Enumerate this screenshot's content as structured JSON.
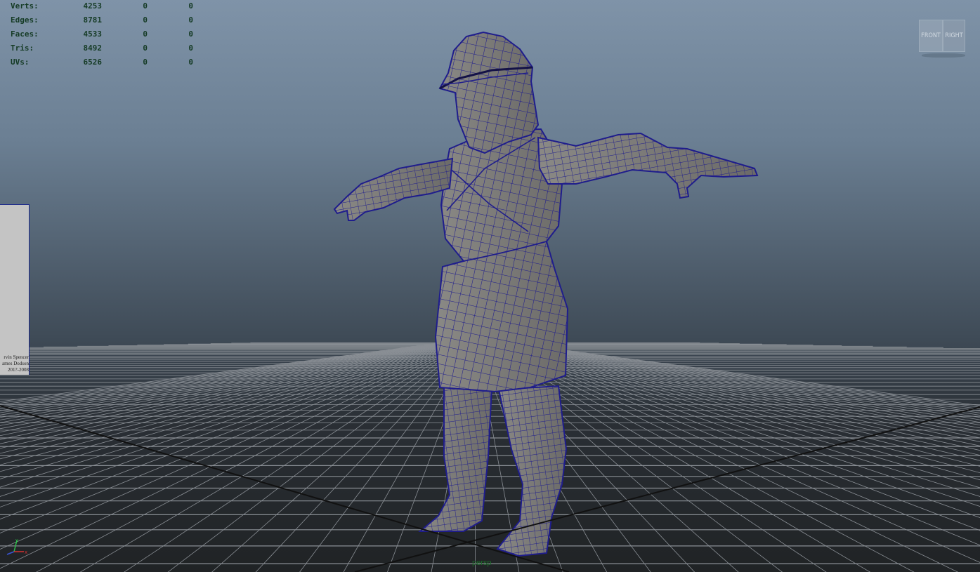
{
  "hud": {
    "rows": [
      {
        "label": "Verts:",
        "v1": "4253",
        "v2": "0",
        "v3": "0"
      },
      {
        "label": "Edges:",
        "v1": "8781",
        "v2": "0",
        "v3": "0"
      },
      {
        "label": "Faces:",
        "v1": "4533",
        "v2": "0",
        "v3": "0"
      },
      {
        "label": "Tris:",
        "v1": "8492",
        "v2": "0",
        "v3": "0"
      },
      {
        "label": "UVs:",
        "v1": "6526",
        "v2": "0",
        "v3": "0"
      }
    ]
  },
  "viewcube": {
    "front": "FRONT",
    "right": "RIGHT"
  },
  "image_plane": {
    "credits": [
      "rvin Spencer",
      "ames Dodson",
      "201?-2008"
    ]
  },
  "axis": {
    "x": "x",
    "y": "y"
  },
  "camera": {
    "name": "persp"
  },
  "colors": {
    "wireframe": "#1f1d8c",
    "mesh_fill": "#7d7d7a",
    "grid_line": "#8a8f95",
    "grid_axis": "#111111",
    "hud_text": "#153b25"
  }
}
